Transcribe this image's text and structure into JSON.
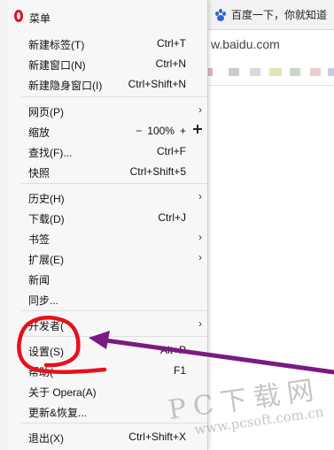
{
  "browser_tab": {
    "title": "百度一下，你就知道",
    "icon": "baidu-paw-icon"
  },
  "address_bar": {
    "text": "w.baidu.com"
  },
  "menu": {
    "title": "菜单",
    "logo_icon": "opera-logo-icon",
    "items": [
      {
        "label": "新建标签(T)",
        "shortcut": "Ctrl+T"
      },
      {
        "label": "新建窗口(N)",
        "shortcut": "Ctrl+N"
      },
      {
        "label": "新建隐身窗口(I)",
        "shortcut": "Ctrl+Shift+N"
      },
      {
        "label": "网页(P)",
        "submenu": true
      },
      {
        "label": "缩放",
        "zoom": {
          "minus": "−",
          "value": "100%",
          "plus": "+"
        }
      },
      {
        "label": "查找(F)...",
        "shortcut": "Ctrl+F"
      },
      {
        "label": "快照",
        "shortcut": "Ctrl+Shift+5"
      },
      {
        "label": "历史(H)",
        "submenu": true
      },
      {
        "label": "下载(D)",
        "shortcut": "Ctrl+J"
      },
      {
        "label": "书签",
        "submenu": true
      },
      {
        "label": "扩展(E)",
        "submenu": true
      },
      {
        "label": "新闻"
      },
      {
        "label": "同步..."
      },
      {
        "label": "开发者(",
        "submenu": true
      },
      {
        "label": "设置(S)",
        "shortcut": "Alt+P"
      },
      {
        "label": "帮助(",
        "shortcut": "F1"
      },
      {
        "label": "关于 Opera(A)"
      },
      {
        "label": "更新&恢复..."
      },
      {
        "label": "退出(X)",
        "shortcut": "Ctrl+Shift+X"
      }
    ]
  },
  "annotation": {
    "circle_color": "#e8101c",
    "arrow_color": "#7a1a82"
  },
  "watermark": {
    "title": "PC下载网",
    "url": "www.pcsoft.com.cn"
  }
}
